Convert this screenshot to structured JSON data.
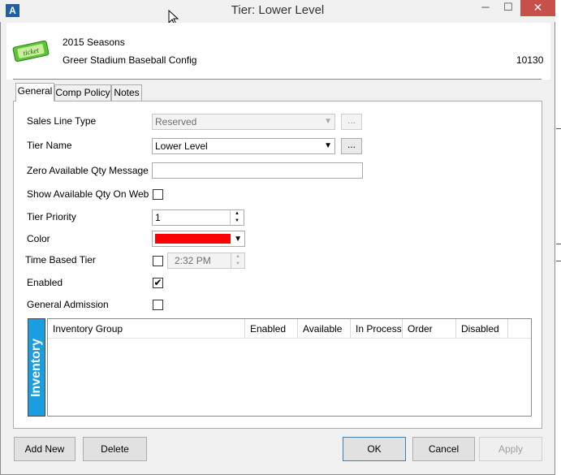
{
  "window": {
    "title": "Tier: Lower Level",
    "app_icon": "A",
    "controls": {
      "minimize": "─",
      "maximize": "☐",
      "close": "✕"
    }
  },
  "header": {
    "icon_text": "ticket",
    "season": "2015 Seasons",
    "config": "Greer Stadium Baseball Config",
    "code": "10130"
  },
  "tabs": [
    {
      "label": "General",
      "active": true
    },
    {
      "label": "Comp Policy",
      "active": false
    },
    {
      "label": "Notes",
      "active": false
    }
  ],
  "form": {
    "sales_line_type": {
      "label": "Sales Line Type",
      "value": "Reserved",
      "button": "...",
      "enabled": false
    },
    "tier_name": {
      "label": "Tier Name",
      "value": "Lower Level",
      "button": "..."
    },
    "zero_qty_message": {
      "label": "Zero Available Qty Message",
      "value": ""
    },
    "show_qty_web": {
      "label": "Show Available Qty On Web",
      "checked": false
    },
    "tier_priority": {
      "label": "Tier Priority",
      "value": "1"
    },
    "color": {
      "label": "Color",
      "value": "#ff0000"
    },
    "time_based_tier": {
      "label": "Time Based Tier",
      "checked": false,
      "time": "2:32 PM"
    },
    "enabled": {
      "label": "Enabled",
      "checked": true,
      "mark": "✔"
    },
    "general_admission": {
      "label": "General Admission",
      "checked": false
    }
  },
  "inventory": {
    "tab_label": "Inventory",
    "columns": [
      "Inventory Group",
      "Enabled",
      "Available",
      "In Process",
      "Order",
      "Disabled"
    ],
    "rows": []
  },
  "buttons": {
    "add_new": "Add New",
    "delete": "Delete",
    "ok": "OK",
    "cancel": "Cancel",
    "apply": "Apply"
  }
}
